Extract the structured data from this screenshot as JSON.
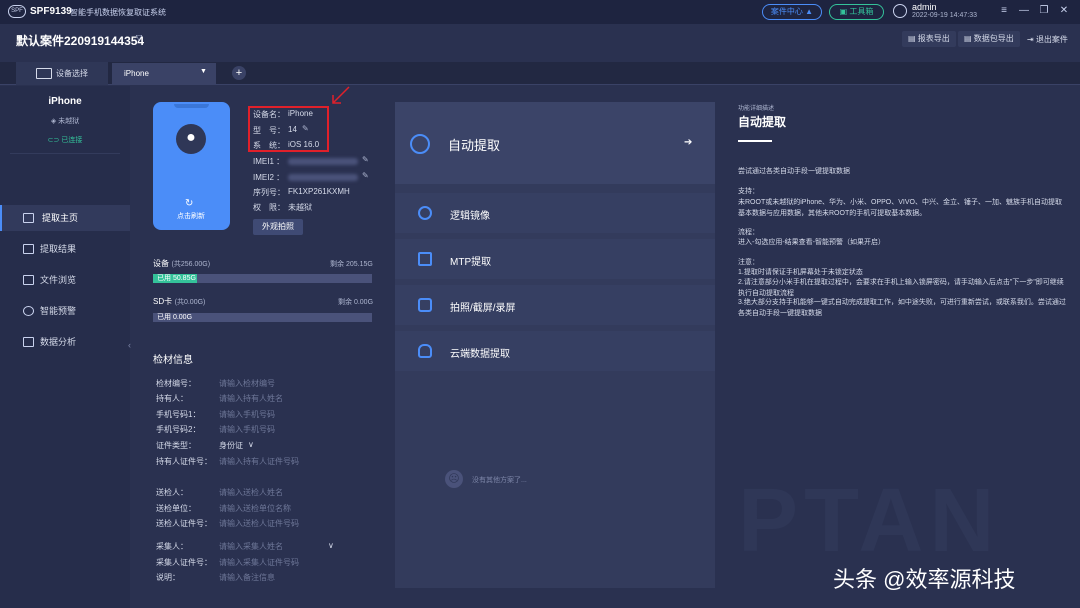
{
  "titlebar": {
    "logo_text": "SPF",
    "app_code": "SPF9139",
    "app_name": "智能手机数据恢复取证系统",
    "case_center": "案件中心",
    "toolbox": "工具箱",
    "user_name": "admin",
    "user_time": "2022-09-19 14:47:33",
    "win_controls": [
      "≡",
      "—",
      "❐",
      "✕"
    ]
  },
  "case": {
    "title": "默认案件220919144354",
    "report_export": "报表导出",
    "data_export": "数据包导出",
    "exit_case": "退出案件"
  },
  "tabs": {
    "device_select": "设备选择",
    "device_dropdown": "iPhone",
    "add": "+"
  },
  "sidebar": {
    "device_name": "iPhone",
    "jailbreak": "未越狱",
    "connected": "已连接",
    "items": [
      {
        "label": "提取主页",
        "active": true
      },
      {
        "label": "提取结果"
      },
      {
        "label": "文件浏览"
      },
      {
        "label": "智能预警"
      },
      {
        "label": "数据分析"
      }
    ]
  },
  "device": {
    "refresh_label": "点击刷新",
    "name_key": "设备名：",
    "name_val": "iPhone",
    "model_key": "型　号：",
    "model_val": "14",
    "os_key": "系　统：",
    "os_val": "iOS 16.0",
    "imei1_key": "IMEI1 ：",
    "imei2_key": "IMEI2 ：",
    "serial_key": "序列号：",
    "serial_val": "FK1XP261KXMH",
    "perm_key": "权　限：",
    "perm_val": "未越狱",
    "ext_photo": "外观拍照"
  },
  "storage": {
    "device_label": "设备",
    "device_total": "(共256.00G)",
    "device_remaining": "剩余 205.15G",
    "device_used": "已用 50.85G",
    "device_used_fraction": 0.199,
    "sd_label": "SD卡",
    "sd_total": "(共0.00G)",
    "sd_remaining": "剩余 0.00G",
    "sd_used": "已用 0.00G"
  },
  "info": {
    "title": "检材信息",
    "fields": [
      {
        "key": "检材编号：",
        "val": "请输入检材编号"
      },
      {
        "key": "持有人：",
        "val": "请输入持有人姓名"
      },
      {
        "key": "手机号码1：",
        "val": "请输入手机号码"
      },
      {
        "key": "手机号码2：",
        "val": "请输入手机号码"
      },
      {
        "key": "证件类型：",
        "val": "身份证"
      },
      {
        "key": "持有人证件号：",
        "val": "请输入持有人证件号码"
      },
      {
        "key": "送检人：",
        "val": "请输入送检人姓名"
      },
      {
        "key": "送检单位：",
        "val": "请输入送检单位名称"
      },
      {
        "key": "送检人证件号：",
        "val": "请输入送检人证件号码"
      },
      {
        "key": "采集人：",
        "val": "请输入采集人姓名"
      },
      {
        "key": "采集人证件号：",
        "val": "请输入采集人证件号码"
      },
      {
        "key": "说明：",
        "val": "请输入备注信息"
      }
    ]
  },
  "methods": {
    "auto": "自动提取",
    "options": [
      "逻辑镜像",
      "MTP提取",
      "拍照/截屏/录屏",
      "云端数据提取"
    ],
    "empty": "没有其他方案了..."
  },
  "detail": {
    "small_label": "功能详细描述",
    "title": "自动提取",
    "intro": "尝试通过各类自动手段一键提取数据",
    "support_title": "支持：",
    "support_text": "未ROOT或未越狱的iPhone、华为、小米、OPPO、VIVO、中兴、金立、锤子、一加、魅族手机自动提取基本数据与应用数据，其他未ROOT的手机可提取基本数据。",
    "flow_title": "流程：",
    "flow_text": "进入-勾选应用-结果查看-智能预警（如果开启）",
    "note_title": "注意：",
    "note1": "1.提取时请保证手机屏幕处于未锁定状态",
    "note2": "2.请注意部分小米手机在提取过程中，会要求在手机上输入锁屏密码，请手动输入后点击\"下一步\"即可继续执行自动提取流程",
    "note3": "3.绝大部分支持手机能够一键式自动完成提取工作，如中途失败，可进行重新尝试，或联系我们。尝试通过各类自动手段一键提取数据"
  },
  "watermark": {
    "bg_text": "PTAN",
    "text": "头条 @效率源科技"
  },
  "colors": {
    "accent": "#4b8df8",
    "success": "#34c29a",
    "highlight": "#e0202a"
  }
}
